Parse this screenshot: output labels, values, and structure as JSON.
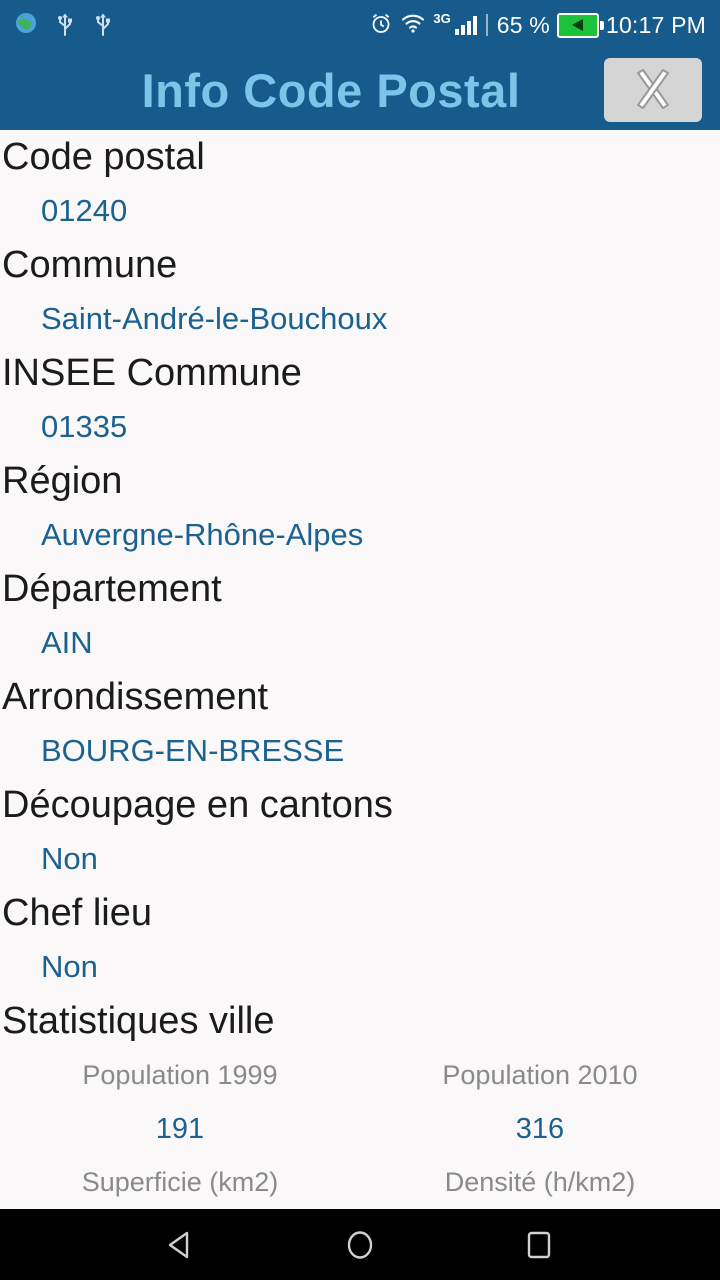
{
  "statusbar": {
    "icons_left": [
      "globe-icon",
      "usb-icon",
      "usb-icon"
    ],
    "alarm_icon": "alarm-icon",
    "wifi_icon": "wifi-icon",
    "network_type": "3G",
    "signal_icon": "signal-bars-icon",
    "battery_percent": "65 %",
    "battery_icon": "battery-charging-icon",
    "time": "10:17 PM"
  },
  "appbar": {
    "title": "Info Code Postal",
    "close_icon": "close-icon",
    "bg_color": "#175a8c",
    "title_color": "#7cc4e8"
  },
  "content": {
    "value_color": "#1c6291",
    "label_color": "#1b1b1b",
    "fields": [
      {
        "label": "Code postal",
        "value": "01240"
      },
      {
        "label": "Commune",
        "value": "Saint-André-le-Bouchoux"
      },
      {
        "label": "INSEE Commune",
        "value": "01335"
      },
      {
        "label": "Région",
        "value": "Auvergne-Rhône-Alpes"
      },
      {
        "label": "Département",
        "value": "AIN"
      },
      {
        "label": "Arrondissement",
        "value": "BOURG-EN-BRESSE"
      },
      {
        "label": "Découpage en cantons",
        "value": "Non"
      },
      {
        "label": "Chef lieu",
        "value": "Non"
      }
    ],
    "stats": {
      "title": "Statistiques ville",
      "cells": [
        {
          "name": "Population 1999",
          "value": "191"
        },
        {
          "name": "Population 2010",
          "value": "316"
        },
        {
          "name": "Superficie (km2)",
          "value": ""
        },
        {
          "name": "Densité (h/km2)",
          "value": ""
        }
      ]
    }
  },
  "navbar": {
    "back": "back-icon",
    "home": "home-icon",
    "recents": "recents-icon"
  }
}
